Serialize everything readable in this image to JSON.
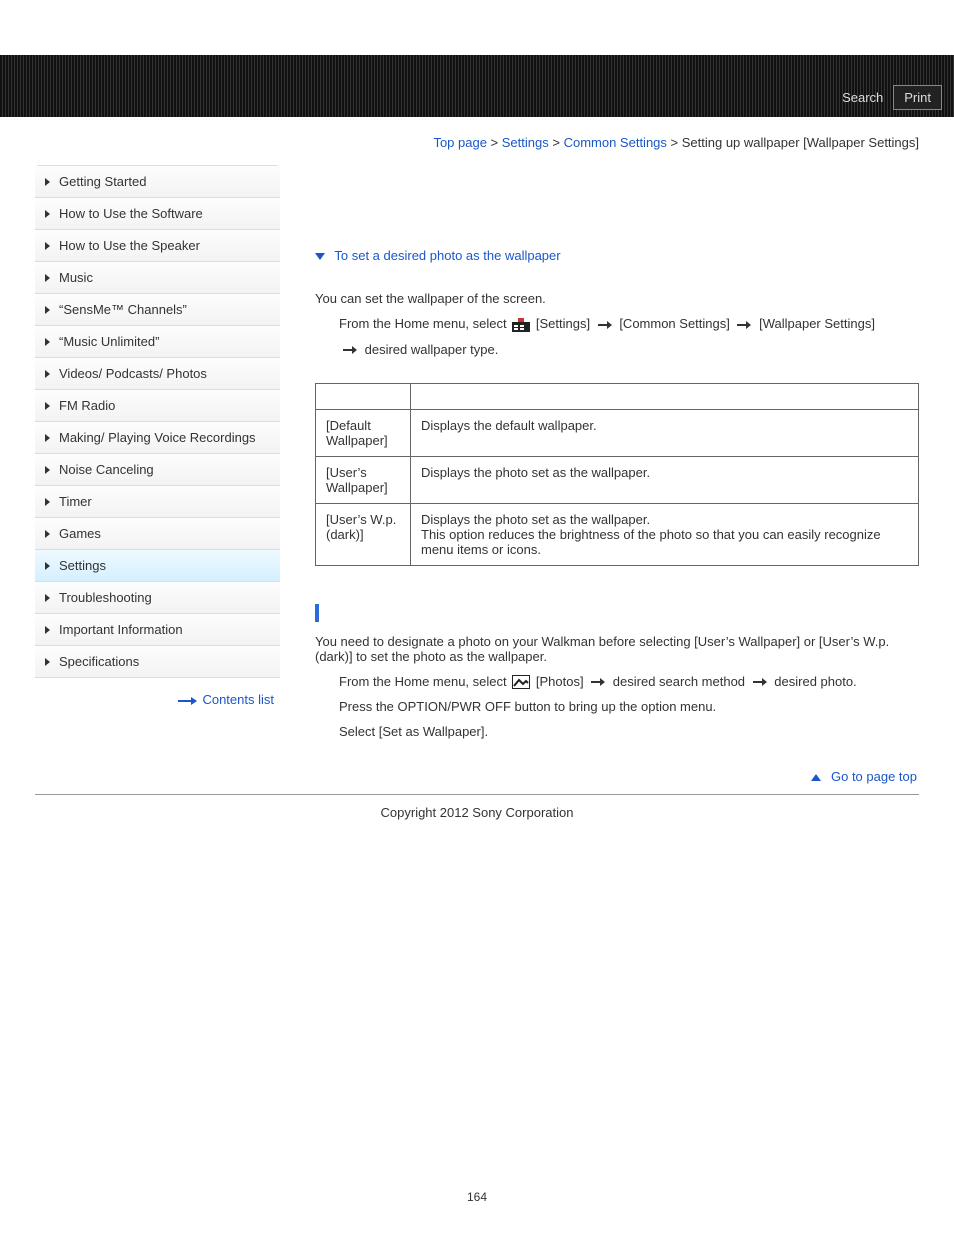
{
  "header": {
    "search": "Search",
    "print": "Print"
  },
  "breadcrumb": {
    "items": [
      "Top page",
      "Settings",
      "Common Settings"
    ],
    "current": "Setting up wallpaper [Wallpaper Settings]",
    "sep": " > "
  },
  "sidebar": {
    "items": [
      {
        "label": "Getting Started"
      },
      {
        "label": "How to Use the Software"
      },
      {
        "label": "How to Use the Speaker"
      },
      {
        "label": "Music"
      },
      {
        "label": "“SensMe™ Channels”"
      },
      {
        "label": "“Music Unlimited”"
      },
      {
        "label": "Videos/ Podcasts/ Photos"
      },
      {
        "label": "FM Radio"
      },
      {
        "label": "Making/ Playing Voice Recordings"
      },
      {
        "label": "Noise Canceling"
      },
      {
        "label": "Timer"
      },
      {
        "label": "Games"
      },
      {
        "label": "Settings",
        "active": true
      },
      {
        "label": "Troubleshooting"
      },
      {
        "label": "Important Information"
      },
      {
        "label": "Specifications"
      }
    ],
    "contents_list": "Contents list"
  },
  "content": {
    "anchor": "To set a desired photo as the wallpaper",
    "intro": "You can set the wallpaper of the screen.",
    "step1_prefix": "From the Home menu, select ",
    "step1_settings": "[Settings]",
    "step1_common": " [Common Settings] ",
    "step1_wallpaper": " [Wallpaper Settings]",
    "step1_tail": " desired wallpaper type.",
    "table": {
      "rows": [
        {
          "name": "[Default Wallpaper]",
          "desc": "Displays the default wallpaper."
        },
        {
          "name": "[User’s Wallpaper]",
          "desc": "Displays the photo set as the wallpaper."
        },
        {
          "name": "[User’s W.p.(dark)]",
          "desc": "Displays the photo set as the wallpaper.\nThis option reduces the brightness of the photo so that you can easily recognize menu items or icons."
        }
      ]
    },
    "note": "You need to designate a photo on your Walkman before selecting [User’s Wallpaper] or [User’s W.p.(dark)] to set the photo as the wallpaper.",
    "note_step1_prefix": "From the Home menu, select ",
    "note_step1_photos": "[Photos] ",
    "note_step1_mid": " desired search method ",
    "note_step1_tail": " desired photo.",
    "note_step2": "Press the OPTION/PWR OFF button to bring up the option menu.",
    "note_step3": "Select [Set as Wallpaper].",
    "goto": "Go to page top"
  },
  "footer": {
    "copyright": "Copyright 2012 Sony Corporation",
    "page": "164"
  }
}
